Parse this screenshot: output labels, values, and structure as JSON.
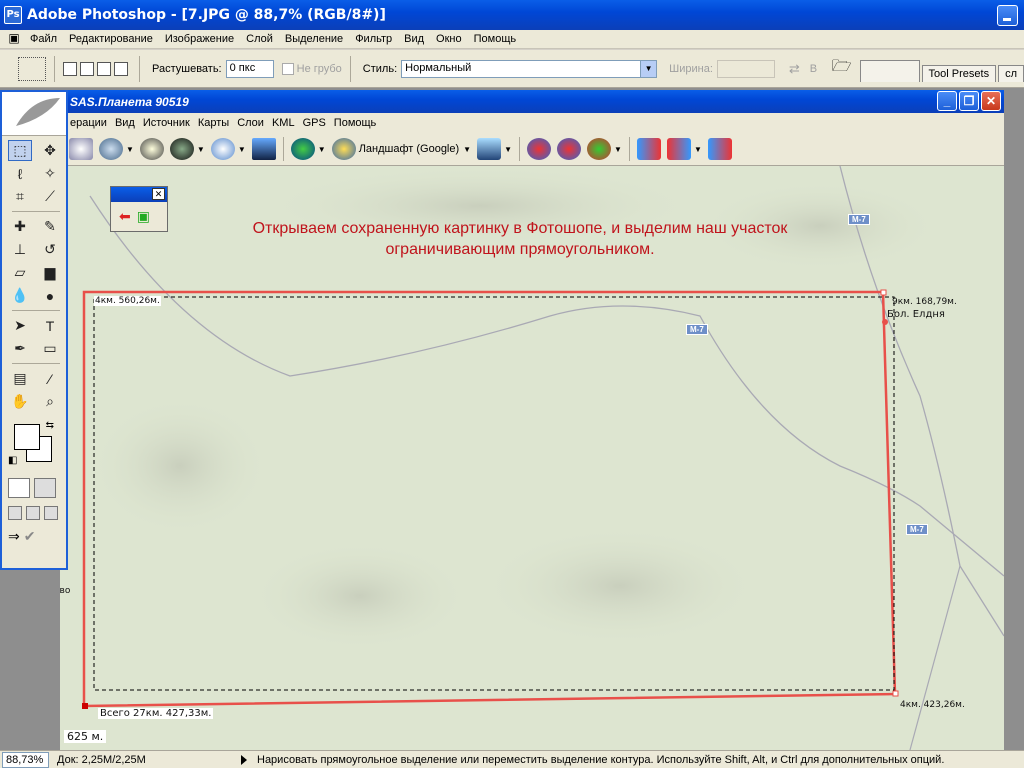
{
  "titlebar": {
    "title": "Adobe Photoshop - [7.JPG @ 88,7% (RGB/8#)]"
  },
  "menubar": {
    "items": [
      "Файл",
      "Редактирование",
      "Изображение",
      "Слой",
      "Выделение",
      "Фильтр",
      "Вид",
      "Окно",
      "Помощь"
    ]
  },
  "options": {
    "feather_label": "Растушевать:",
    "feather_value": "0 пкс",
    "antialias_label": "Не грубо",
    "style_label": "Стиль:",
    "style_value": "Нормальный",
    "width_label": "Ширина:",
    "height_label_partial": "В",
    "tabs": [
      "Tool Presets",
      "сл"
    ]
  },
  "sas": {
    "title": "SAS.Планета 90519",
    "menu": [
      "ерации",
      "Вид",
      "Источник",
      "Карты",
      "Слои",
      "KML",
      "GPS",
      "Помощь"
    ],
    "map_source": "Ландшафт (Google)"
  },
  "map": {
    "annotation_line1": "Открываем сохраненную картинку в Фотошопе, и выделим наш участок",
    "annotation_line2": "ограничивающим прямоугольником.",
    "labels": {
      "dist_top_left": "4км. 560,26м.",
      "dist_top_right": "9км. 168,79м.",
      "place_name": "Бол. Елдня",
      "dist_bottom_right": "4км. 423,26м.",
      "total": "Всего  27км. 427,33м.",
      "scale": "625 м.",
      "side_text": "ево",
      "road_label": "М-7"
    }
  },
  "status": {
    "zoom": "88,73%",
    "doc": "Док: 2,25М/2,25М",
    "hint": "Нарисовать прямоугольное выделение или переместить выделение контура. Используйте Shift, Alt, и Ctrl для дополнительных опций."
  },
  "colors": {
    "accent_blue": "#0047d6",
    "annotation_red": "#c0141c",
    "path_red": "#e8504a"
  }
}
